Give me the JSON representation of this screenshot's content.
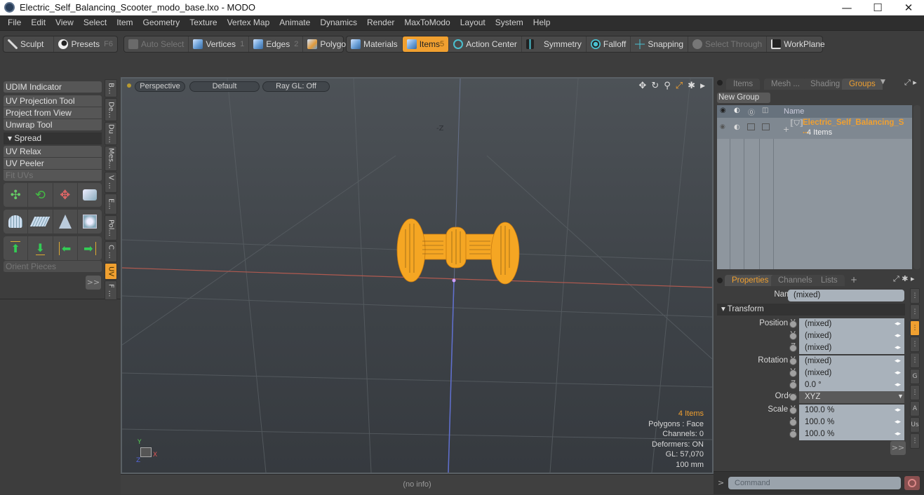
{
  "window": {
    "title": "Electric_Self_Balancing_Scooter_modo_base.lxo - MODO",
    "controls": {
      "minimize": "—",
      "maximize": "☐",
      "close": "✕"
    }
  },
  "menubar": [
    "File",
    "Edit",
    "View",
    "Select",
    "Item",
    "Geometry",
    "Texture",
    "Vertex Map",
    "Animate",
    "Dynamics",
    "Render",
    "MaxToModo",
    "Layout",
    "System",
    "Help"
  ],
  "toolbar": {
    "sculpt": "Sculpt",
    "presets": "Presets",
    "presets_key": "F6",
    "auto_select": "Auto Select",
    "vertices": "Vertices",
    "vertices_key": "1",
    "edges": "Edges",
    "edges_key": "2",
    "polygons": "Polygons",
    "materials": "Materials",
    "items": "Items",
    "items_key": "5",
    "action_center": "Action Center",
    "symmetry": "Symmetry",
    "falloff": "Falloff",
    "snapping": "Snapping",
    "select_through": "Select Through",
    "workplane": "WorkPlane"
  },
  "left_panel": {
    "buttons": [
      "UDIM Indicator",
      "UV Projection Tool",
      "Project from View",
      "Unwrap Tool"
    ],
    "spread_header": "Spread",
    "buttons2": [
      "UV Relax",
      "UV Peeler",
      "Fit UVs"
    ],
    "orient_pieces": "Orient Pieces",
    "more": ">>",
    "vertical_tabs": [
      "B...",
      "De...",
      "Du ...",
      "Mes...",
      "V ...",
      "E...",
      "Pol...",
      "C ...",
      "UV",
      "F ..."
    ],
    "active_tab": "UV"
  },
  "viewport": {
    "view": "Perspective",
    "shading": "Default",
    "raygl": "Ray GL: Off",
    "axis_label": "-Z",
    "info": {
      "items": "4 Items",
      "polygons": "Polygons : Face",
      "channels": "Channels: 0",
      "deformers": "Deformers: ON",
      "gl": "GL: 57,070",
      "scale": "100 mm"
    },
    "axes": {
      "y": "Y",
      "x": "X",
      "z": "Z"
    },
    "model_color": "#f5a623"
  },
  "status": "(no info)",
  "groups_panel": {
    "tabs": [
      "Items",
      "Mesh ...",
      "Shading",
      "Groups"
    ],
    "active_tab": "Groups",
    "new_group": "New Group",
    "column_name": "Name",
    "group_name": "Electric_Self_Balancing_S ...",
    "group_count": "4 Items"
  },
  "properties_panel": {
    "tabs": [
      "Properties",
      "Channels",
      "Lists",
      "+"
    ],
    "active_tab": "Properties",
    "name_label": "Name",
    "name_value": "(mixed)",
    "transform_header": "Transform",
    "rows": [
      {
        "label": "Position X",
        "value": "(mixed)"
      },
      {
        "label": "Y",
        "value": "(mixed)"
      },
      {
        "label": "Z",
        "value": "(mixed)"
      },
      {
        "label": "Rotation X",
        "value": "(mixed)"
      },
      {
        "label": "Y",
        "value": "(mixed)"
      },
      {
        "label": "Z",
        "value": "0.0 °"
      },
      {
        "label": "Order",
        "value": "XYZ"
      },
      {
        "label": "Scale X",
        "value": "100.0 %"
      },
      {
        "label": "Y",
        "value": "100.0 %"
      },
      {
        "label": "Z",
        "value": "100.0 %"
      }
    ],
    "more": ">>",
    "side_tabs": [
      "⋮",
      "⋮",
      "⋮",
      "⋮",
      "⋮",
      "G",
      "⋮",
      "A",
      "Us",
      "⋮"
    ]
  },
  "command": {
    "prompt": ">",
    "placeholder": "Command"
  },
  "colors": {
    "accent": "#f0a030",
    "viewport_bg": "#41464b"
  }
}
